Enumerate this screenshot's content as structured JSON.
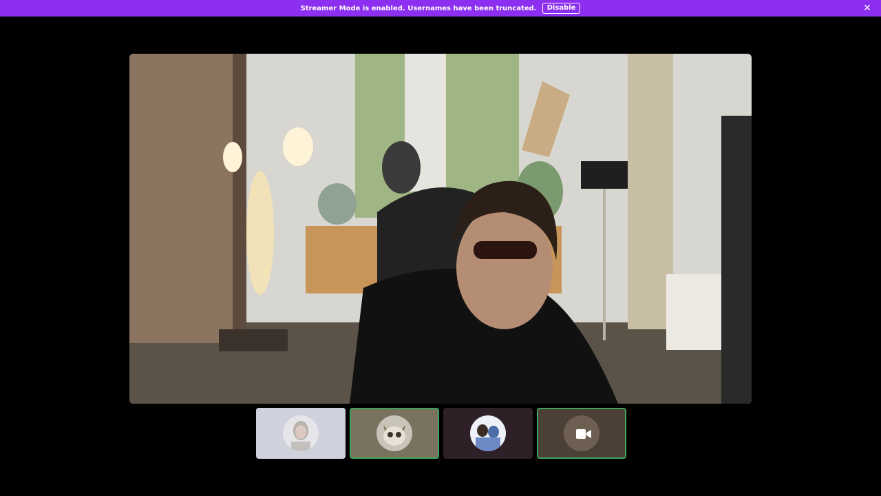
{
  "banner": {
    "message": "Streamer Mode is enabled. Usernames have been truncated.",
    "disable_label": "Disable",
    "close_icon": "close-icon",
    "color": "#8c2ff0"
  },
  "participants": [
    {
      "icon": "avatar-woman-icon",
      "background": "#cfd2dd",
      "speaking": false
    },
    {
      "icon": "avatar-cat-icon",
      "background": "#78725f",
      "speaking": true
    },
    {
      "icon": "avatar-couple-icon",
      "background": "#2e2026",
      "speaking": false
    },
    {
      "icon": "camera-icon",
      "background": "#4c4036",
      "speaking": true
    }
  ],
  "accent_colors": {
    "speaking_outline": "#3ba55d",
    "background": "#000000"
  }
}
